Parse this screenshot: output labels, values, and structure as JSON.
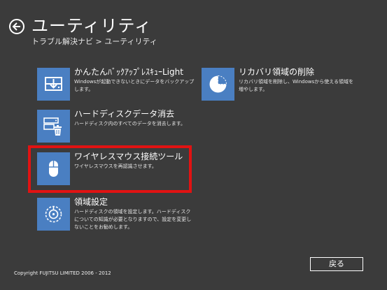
{
  "header": {
    "title": "ユーティリティ",
    "breadcrumb_parent": "トラブル解決ナビ",
    "breadcrumb_sep": ">",
    "breadcrumb_current": "ユーティリティ",
    "back_icon": "arrow-left-circle-icon"
  },
  "tiles": [
    {
      "title": "かんたんﾊﾞｯｸｱｯﾌﾟﾚｽｷｭｰLight",
      "desc": "Windowsが起動できないときにデータをバックアップします。",
      "icon": "backup-drive-icon"
    },
    {
      "title": "リカバリ領域の削除",
      "desc": "リカバリ領域を削除し、Windowsから使える領域を増やします。",
      "icon": "pie-disk-icon"
    },
    {
      "title": "ハードディスクデータ消去",
      "desc": "ハードディスク内のすべてのデータを消去します。",
      "icon": "disk-erase-icon"
    },
    {
      "title": "ワイヤレスマウス接続ツール",
      "desc": "ワイヤレスマウスを再認識させます。",
      "icon": "mouse-icon"
    },
    {
      "title": "領域設定",
      "desc": "ハードディスクの領域を設定します。ハードディスクについての知識が必要となりますので、設定を変更しないことをお勧めします。",
      "icon": "partition-disk-icon"
    }
  ],
  "footer": {
    "copyright": "Copyright FUJITSU LIMITED 2006 - 2012",
    "return_label": "戻る"
  },
  "colors": {
    "background": "#3b3b3b",
    "tile_icon": "#4a7fc2",
    "highlight": "#e11212"
  }
}
